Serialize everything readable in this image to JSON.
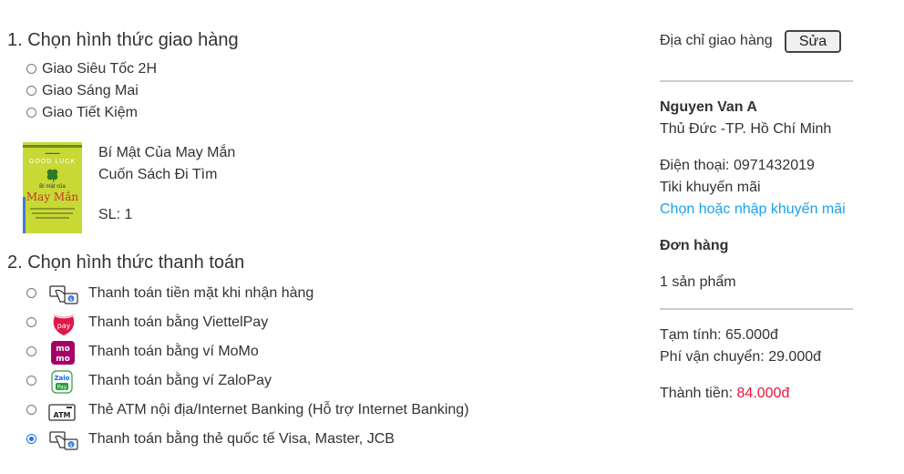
{
  "shipping": {
    "heading": "1. Chọn hình thức giao hàng",
    "options": [
      {
        "label": "Giao Siêu Tốc 2H",
        "selected": false
      },
      {
        "label": "Giao Sáng Mai",
        "selected": false
      },
      {
        "label": "Giao Tiết Kiệm",
        "selected": false
      }
    ]
  },
  "product": {
    "title_line1": "Bí Mật Của May Mắn",
    "title_line2": "Cuốn Sách Đi Tìm",
    "quantity": "SL: 1",
    "cover": {
      "top_text": "GOOD LUCK",
      "title_small": "Bí mật của",
      "title_big": "May Mắn"
    }
  },
  "payment": {
    "heading": "2. Chọn hình thức thanh toán",
    "options": [
      {
        "label": "Thanh toán tiền mặt khi nhận hàng",
        "icon": "cash-on-delivery-icon",
        "selected": false
      },
      {
        "label": "Thanh toán bằng ViettelPay",
        "icon": "viettelpay-icon",
        "selected": false
      },
      {
        "label": "Thanh toán bằng ví MoMo",
        "icon": "momo-icon",
        "selected": false
      },
      {
        "label": "Thanh toán bằng ví ZaloPay",
        "icon": "zalopay-icon",
        "selected": false
      },
      {
        "label": "Thẻ ATM nội địa/Internet Banking (Hỗ trợ Internet Banking)",
        "icon": "atm-icon",
        "selected": false
      },
      {
        "label": "Thanh toán bằng thẻ quốc tế Visa, Master, JCB",
        "icon": "card-payment-icon",
        "selected": true
      }
    ]
  },
  "summary": {
    "address_label": "Địa chỉ giao hàng",
    "edit_label": "Sửa",
    "name": "Nguyen Van A",
    "address": "Thủ Đức -TP. Hồ Chí Minh",
    "phone": "Điện thoại: 0971432019",
    "promo_label": "Tiki khuyến mãi",
    "promo_link": "Chọn hoặc nhập khuyến mãi",
    "order_heading": "Đơn hàng",
    "product_count": "1 sản phẩm",
    "subtotal": "Tạm tính: 65.000đ",
    "shipping_fee": "Phí vận chuyển: 29.000đ",
    "total_label": "Thành tiền:",
    "total_value": "84.000đ"
  },
  "colors": {
    "accent": "#1aa3e8",
    "price": "#e8173c",
    "radio_checked": "#1a73e8",
    "momo": "#a50064",
    "viettel": "#e0184a",
    "zalopay": "#0068ff"
  }
}
